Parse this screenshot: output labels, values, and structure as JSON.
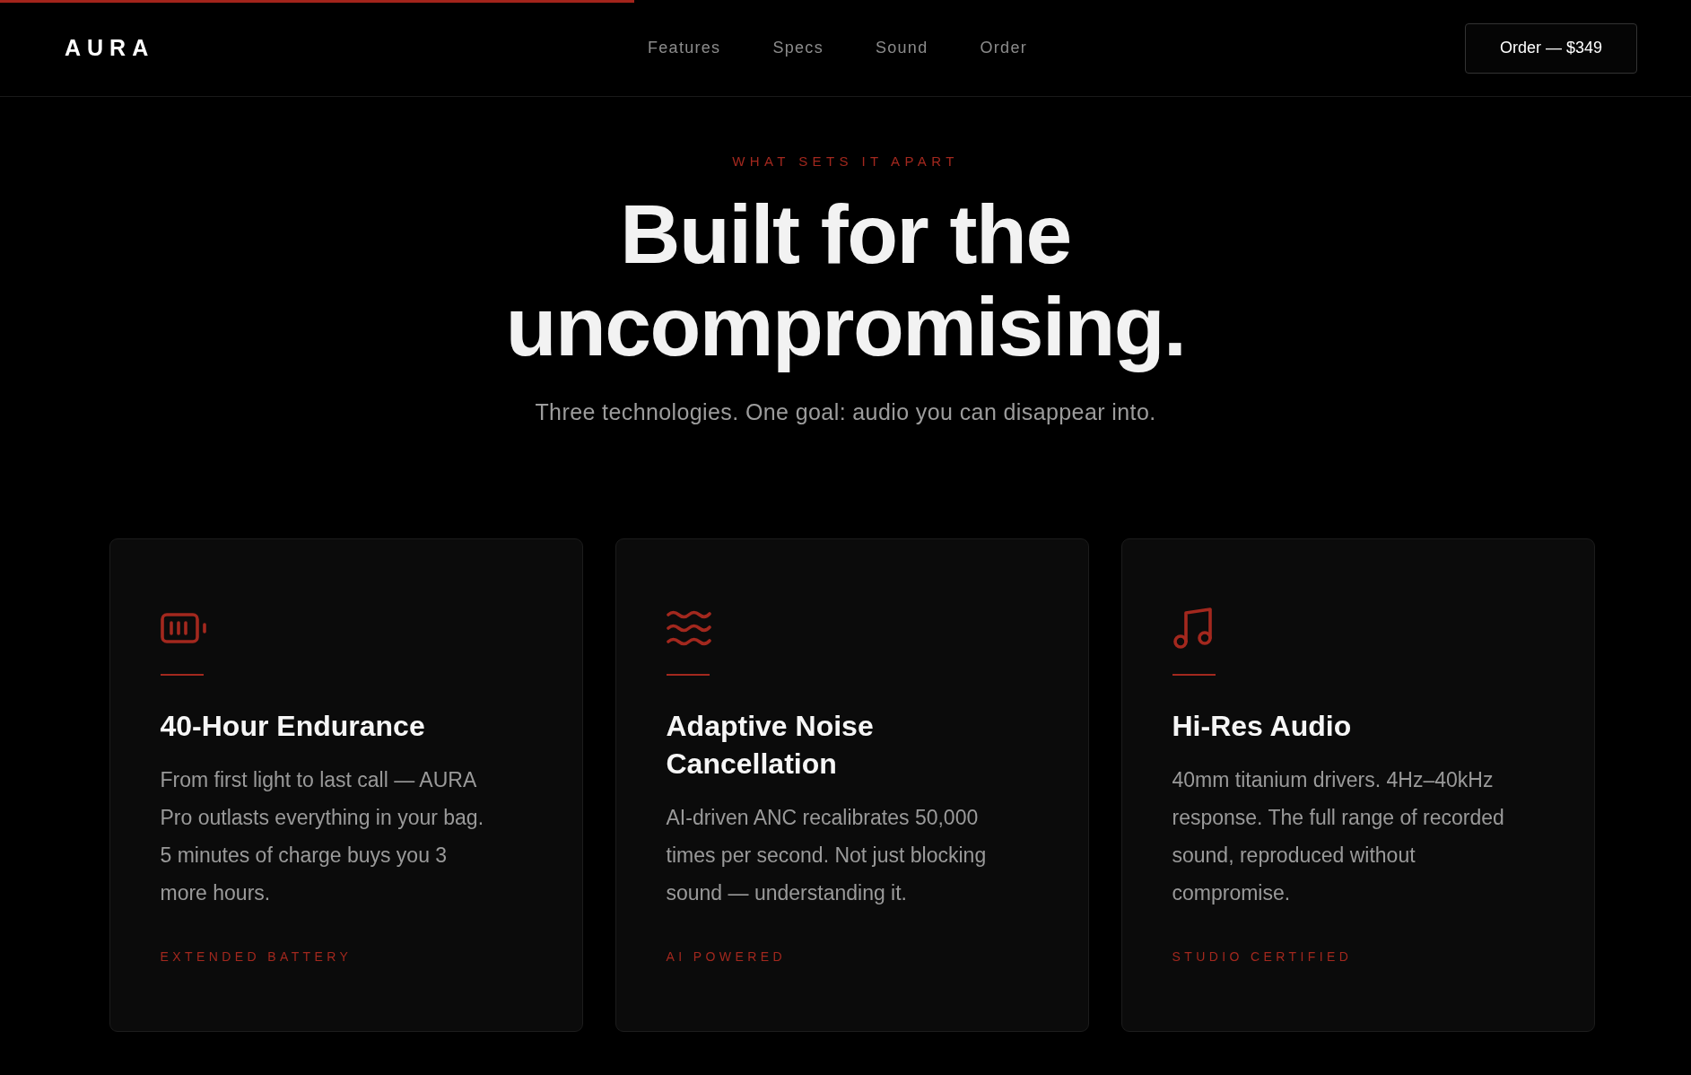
{
  "scroll_progress": {
    "level": 0.375
  },
  "header": {
    "logo": "AURA",
    "nav": [
      "Features",
      "Specs",
      "Sound",
      "Order"
    ],
    "cta": "Order — $349"
  },
  "hero": {
    "eyebrow": "WHAT SETS IT APART",
    "title": "Built for the uncompromising.",
    "subtitle": "Three technologies. One goal: audio you can disappear into."
  },
  "features": [
    {
      "kind": "battery",
      "title": "40-Hour Endurance",
      "description": "From first light to last call — AURA Pro outlasts everything in your bag. 5 minutes of charge buys you 3 more hours.",
      "tag": "EXTENDED BATTERY"
    },
    {
      "kind": "waves",
      "title": "Adaptive Noise Cancellation",
      "description": "AI-driven ANC recalibrates 50,000 times per second. Not just blocking sound — understanding it.",
      "tag": "AI POWERED"
    },
    {
      "kind": "music",
      "title": "Hi-Res Audio",
      "description": "40mm titanium drivers. 4Hz–40kHz response. The full range of recorded sound, reproduced without compromise.",
      "tag": "STUDIO CERTIFIED"
    }
  ]
}
